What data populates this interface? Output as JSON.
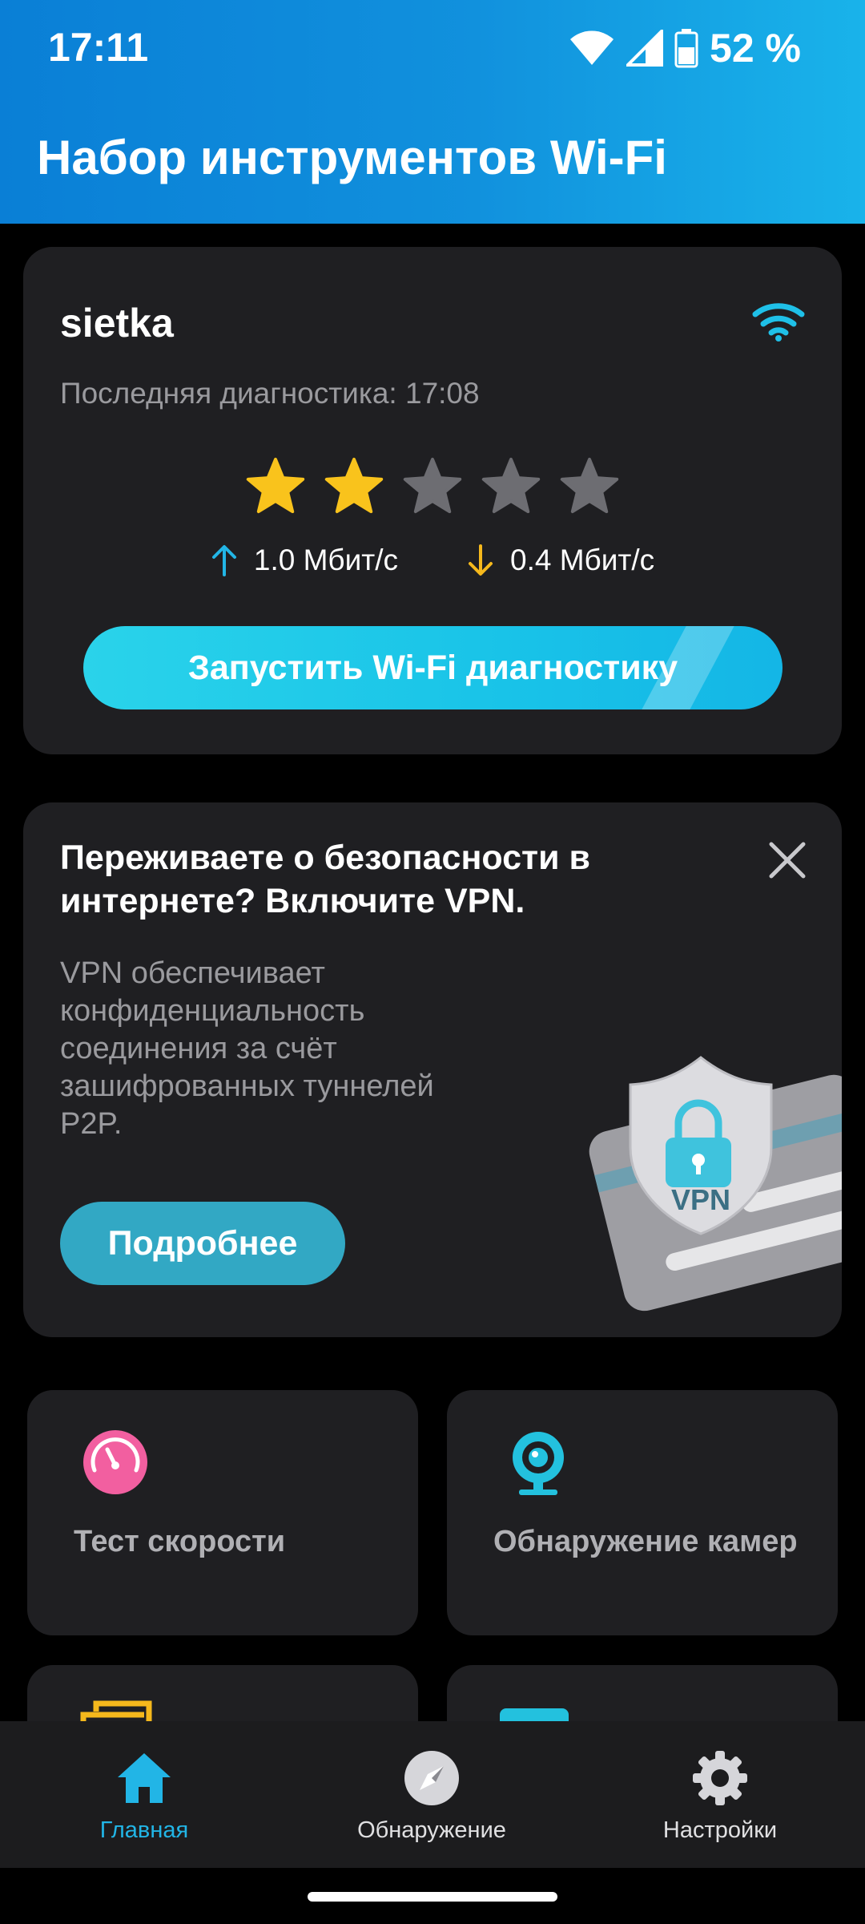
{
  "status_bar": {
    "time": "17:11",
    "battery": "52 %",
    "icons": [
      "wifi-icon",
      "cell-signal-icon",
      "battery-icon"
    ]
  },
  "app": {
    "title": "Набор инструментов Wi-Fi"
  },
  "network_card": {
    "network_name": "sietka",
    "last_diagnostic": "Последняя диагностика: 17:08",
    "rating": {
      "value": 2,
      "max": 5
    },
    "upload_speed": "1.0 Мбит/с",
    "download_speed": "0.4 Мбит/с",
    "run_button_label": "Запустить Wi-Fi диагностику"
  },
  "vpn_card": {
    "title": "Переживаете о безопасности в интернете? Включите VPN.",
    "description": "VPN обеспечивает конфиденциальность соединения за счёт зашифрованных туннелей P2P.",
    "more_button_label": "Подробнее",
    "badge_text": "VPN"
  },
  "tiles": [
    {
      "label": "Тест скорости",
      "icon": "speedometer-icon"
    },
    {
      "label": "Обнаружение камер",
      "icon": "webcam-icon"
    }
  ],
  "bottom_nav": [
    {
      "label": "Главная",
      "icon": "home-icon",
      "active": true
    },
    {
      "label": "Обнаружение",
      "icon": "compass-icon",
      "active": false
    },
    {
      "label": "Настройки",
      "icon": "gear-icon",
      "active": false
    }
  ],
  "colors": {
    "accent": "#1fc0e8",
    "star_active": "#f9c31c",
    "star_inactive": "#6d6d72",
    "upload_arrow": "#22b5e6",
    "download_arrow": "#f5b81c",
    "card_bg": "#1f1f22",
    "speed_icon": "#f25fa0"
  }
}
